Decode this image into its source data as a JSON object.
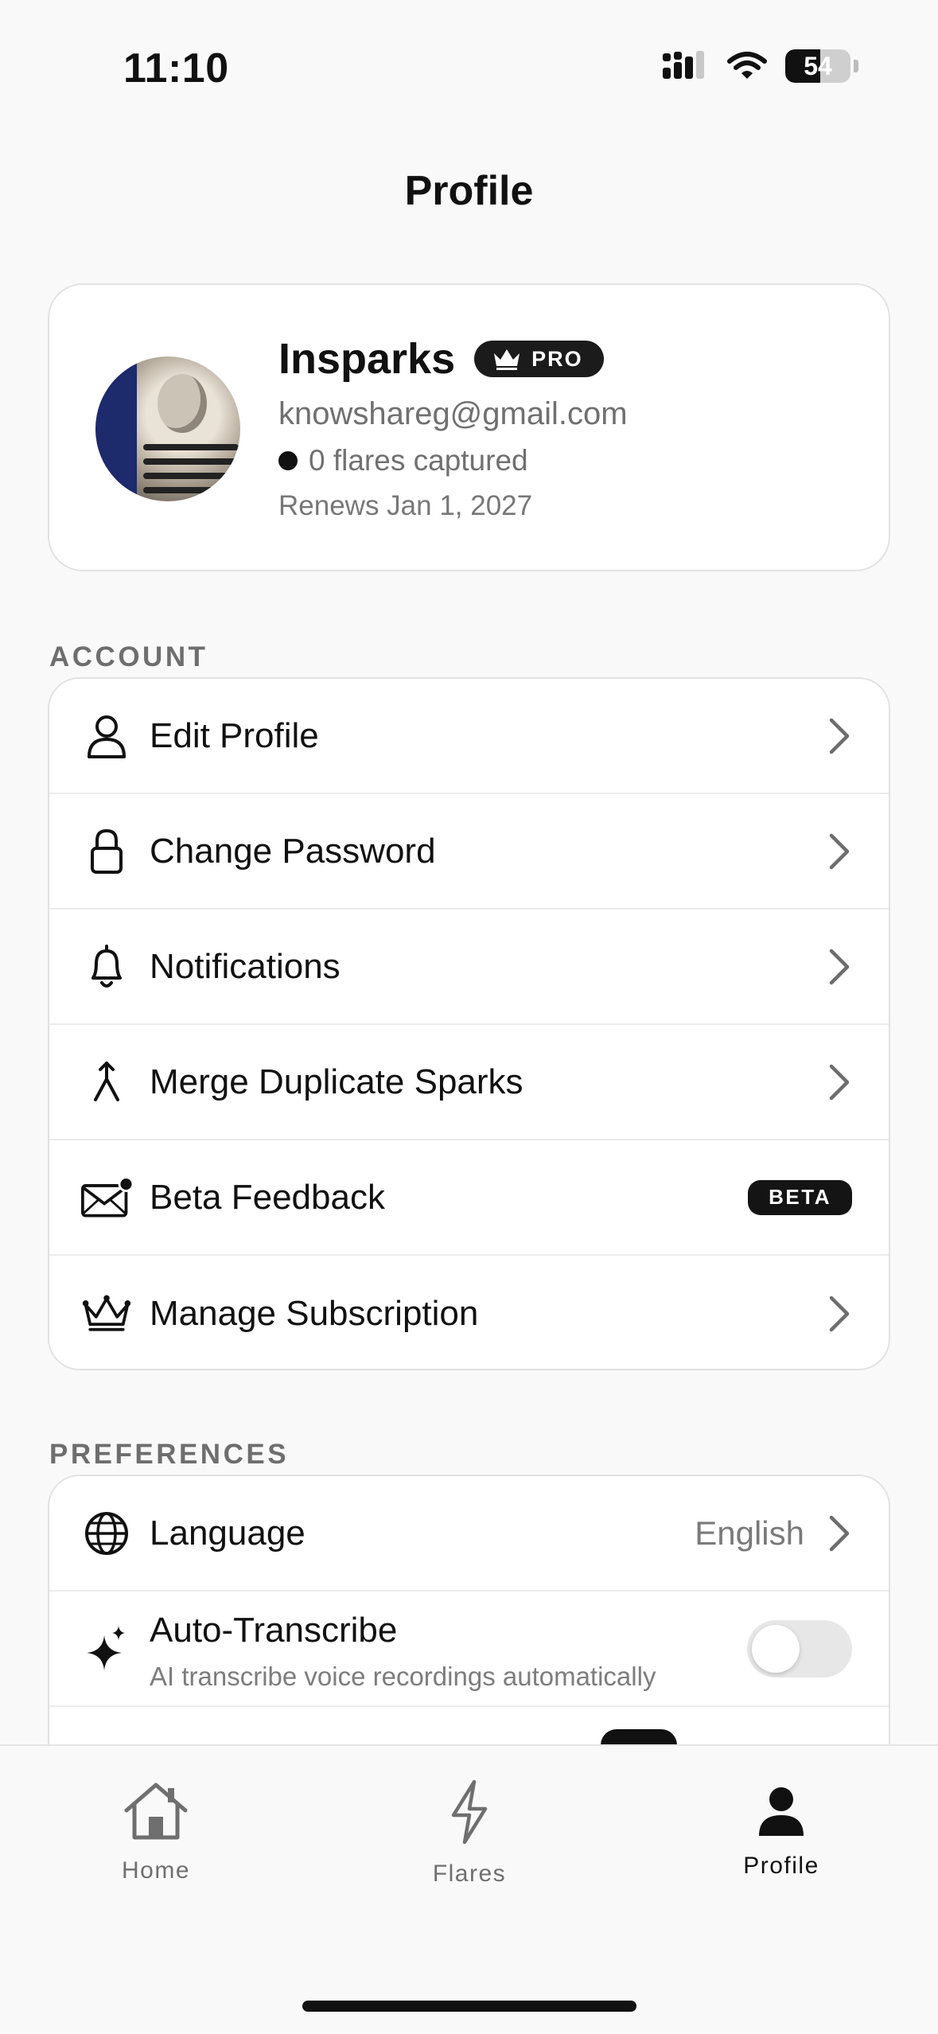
{
  "status_bar": {
    "time": "11:10",
    "battery": "54"
  },
  "header": {
    "title": "Profile"
  },
  "profile": {
    "name": "Insparks",
    "badge": "PRO",
    "email": "knowshareg@gmail.com",
    "flares": "0 flares captured",
    "renews": "Renews Jan 1, 2027"
  },
  "account": {
    "label": "ACCOUNT",
    "items": [
      {
        "label": "Edit Profile",
        "icon": "person-icon"
      },
      {
        "label": "Change Password",
        "icon": "lock-icon"
      },
      {
        "label": "Notifications",
        "icon": "bell-icon"
      },
      {
        "label": "Merge Duplicate Sparks",
        "icon": "merge-icon"
      },
      {
        "label": "Beta Feedback",
        "icon": "mail-icon",
        "badge": "BETA"
      },
      {
        "label": "Manage Subscription",
        "icon": "crown-icon"
      }
    ]
  },
  "preferences": {
    "label": "PREFERENCES",
    "language": {
      "label": "Language",
      "value": "English"
    },
    "auto_transcribe": {
      "label": "Auto-Transcribe",
      "sub": "AI transcribe voice recordings automatically",
      "enabled": false
    }
  },
  "tabs": [
    {
      "label": "Home",
      "active": false
    },
    {
      "label": "Flares",
      "active": false
    },
    {
      "label": "Profile",
      "active": true
    }
  ]
}
